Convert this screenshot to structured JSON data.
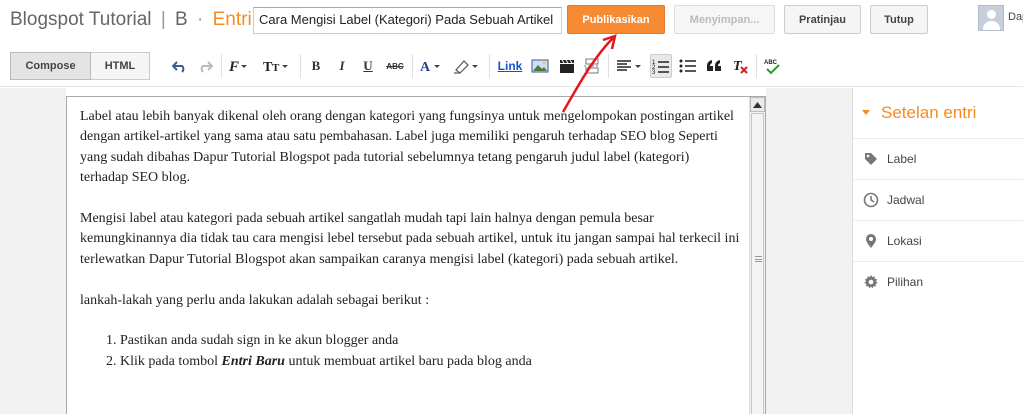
{
  "header": {
    "blog_name": "Blogspot Tutorial",
    "separator": "|",
    "b_letter": "B",
    "dot": "·",
    "section": "Entri",
    "post_title": "Cara Mengisi Label (Kategori) Pada Sebuah Artikel",
    "publish_label": "Publikasikan",
    "saving_label": "Menyimpan...",
    "preview_label": "Pratinjau",
    "close_label": "Tutup",
    "user_name": "Dap"
  },
  "toolbar": {
    "compose_label": "Compose",
    "html_label": "HTML",
    "link_label": "Link",
    "bold": "B",
    "italic": "I",
    "underline": "U",
    "strike": "ABC",
    "font_icon": "font-family-icon",
    "size_icon": "font-size-icon",
    "spellcheck": "ABC"
  },
  "editor": {
    "paragraphs": [
      "Label atau lebih banyak dikenal oleh orang dengan kategori yang fungsinya untuk mengelompokan postingan artikel dengan artikel-artikel yang sama atau satu pembahasan. Label juga memiliki pengaruh terhadap SEO blog Seperti yang sudah dibahas Dapur Tutorial Blogspot pada tutorial sebelumnya tetang pengaruh judul label (kategori) terhadap SEO blog.",
      "Mengisi label atau kategori pada sebuah artikel sangatlah mudah tapi lain halnya dengan pemula besar kemungkinannya dia tidak tau cara mengisi lebel tersebut pada sebuah artikel, untuk itu jangan sampai hal terkecil ini terlewatkan Dapur Tutorial Blogspot akan sampaikan caranya mengisi label (kategori) pada sebuah artikel.",
      "lankah-lakah yang perlu anda lakukan adalah sebagai berikut :"
    ],
    "list_item_1": "Pastikan anda sudah sign in ke akun blogger anda",
    "list_item_2_before": "Klik pada tombol ",
    "list_item_2_bold": "Entri Baru",
    "list_item_2_after": " untuk membuat artikel baru pada blog anda"
  },
  "sidebar": {
    "title": "Setelan entri",
    "items": [
      {
        "label": "Label",
        "icon": "tag-icon"
      },
      {
        "label": "Jadwal",
        "icon": "clock-icon"
      },
      {
        "label": "Lokasi",
        "icon": "location-pin-icon"
      },
      {
        "label": "Pilihan",
        "icon": "gear-icon"
      }
    ]
  },
  "colors": {
    "accent": "#f68b1f",
    "publish": "#f68b34",
    "annotation_arrow": "#e8141b"
  }
}
